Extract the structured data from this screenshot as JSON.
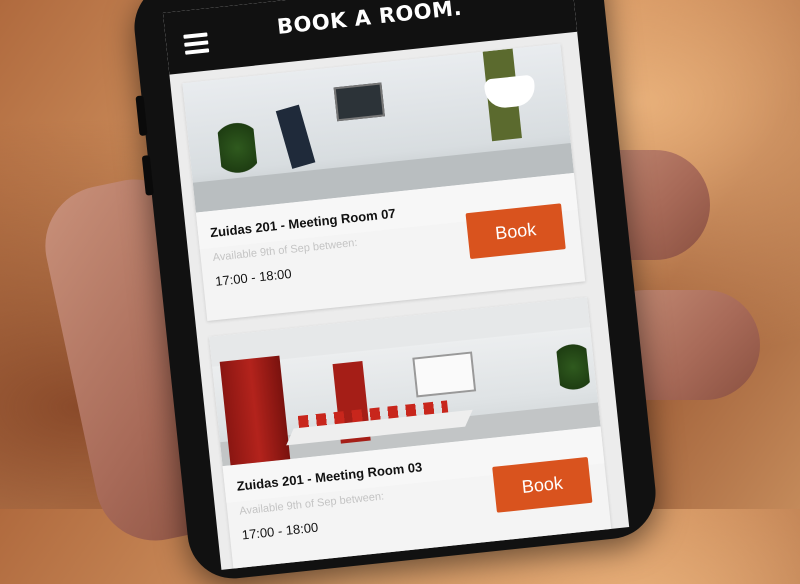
{
  "app": {
    "title": "BOOK A ROOM."
  },
  "header": {
    "menu_icon": "hamburger-menu-icon"
  },
  "rooms": [
    {
      "name": "Zuidas 201 - Meeting Room 07",
      "availability_label": "Available 9th of Sep between:",
      "time": "17:00 - 18:00",
      "book_label": "Book"
    },
    {
      "name": "Zuidas 201 - Meeting Room 03",
      "availability_label": "Available 9th of Sep between:",
      "time": "17:00 - 18:00",
      "book_label": "Book"
    }
  ],
  "colors": {
    "accent": "#d9531e",
    "appbar": "#111111",
    "background": "#ececec"
  }
}
